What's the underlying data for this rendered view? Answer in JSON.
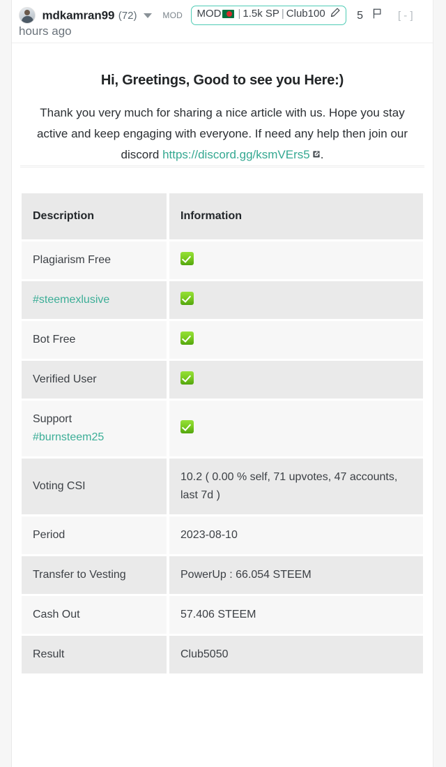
{
  "comment": {
    "author": {
      "username": "mdkamran99",
      "reputation": "(72)",
      "avatar_icon": "user-avatar-photo",
      "dropdown_icon": "chevron-down-icon"
    },
    "role_tag": "MOD",
    "badge": {
      "mod_label": "MOD",
      "flag_icon": "bangladesh-flag-icon",
      "separator": "|",
      "sp_label": "1.5k SP",
      "club_label": "Club100",
      "pen_icon": "pen-icon",
      "border_color": "#4ecbb4"
    },
    "vote_count": "5",
    "flag_icon": "flag-icon",
    "collapse_toggle": "[ - ]",
    "timestamp": "hours ago"
  },
  "content": {
    "title": "Hi, Greetings, Good to see you Here:)",
    "paragraph_before_link": "Thank you very much for sharing a nice article with us. Hope you stay active and keep engaging with everyone. If need any help then join our discord ",
    "discord_link": "https://discord.gg/ksmVErs5",
    "external_link_icon": "external-link-icon",
    "paragraph_after_link": ".",
    "link_color": "#34a891"
  },
  "table": {
    "headers": [
      "Description",
      "Information"
    ],
    "rows": [
      {
        "description": "Plagiarism Free",
        "description_is_link": false,
        "information": "",
        "icon": "green-check-icon",
        "style": "plain"
      },
      {
        "description": "#steemexlusive",
        "description_is_link": true,
        "information": "",
        "icon": "green-check-icon",
        "style": "plain"
      },
      {
        "description": "Bot Free",
        "description_is_link": false,
        "information": "",
        "icon": "green-check-icon",
        "style": "plain"
      },
      {
        "description": "Verified User",
        "description_is_link": false,
        "information": "",
        "icon": "green-check-icon",
        "style": "plain"
      },
      {
        "description": "Support",
        "description_line2": "#burnsteem25",
        "description_is_link": false,
        "description_line2_is_link": true,
        "information": "",
        "icon": "green-check-icon",
        "style": "plain"
      },
      {
        "description": "Voting CSI",
        "description_is_link": false,
        "information": "10.2 ( 0.00 % self, 71 upvotes, 47 accounts, last 7d )",
        "icon": "",
        "style": "plain"
      },
      {
        "description": "Period",
        "description_is_link": false,
        "information": "2023-08-10",
        "icon": "",
        "style": "plain"
      },
      {
        "description": "Transfer to Vesting",
        "description_is_link": false,
        "information": "PowerUp : 66.054 STEEM",
        "icon": "",
        "style": "plain"
      },
      {
        "description": "Cash Out",
        "description_is_link": false,
        "information": "57.406 STEEM",
        "icon": "",
        "style": "red-bold"
      },
      {
        "description": "Result",
        "description_is_link": false,
        "information": "Club5050",
        "icon": "",
        "style": "bold"
      }
    ],
    "red_value_color": "#c0222a",
    "tag_link_color": "#3cae97"
  }
}
